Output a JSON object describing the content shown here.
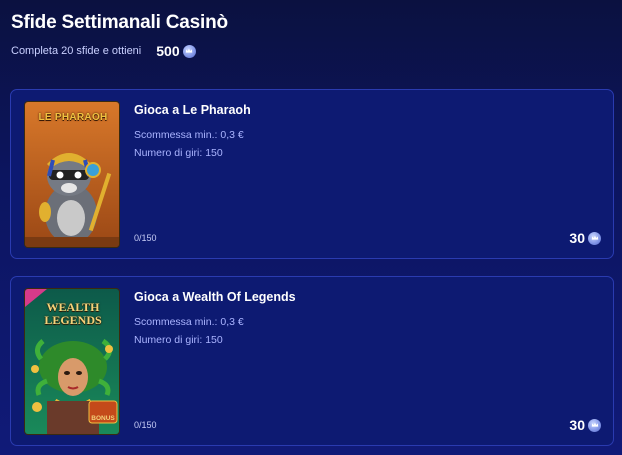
{
  "header": {
    "title": "Sfide Settimanali Casinò",
    "subtitle": "Completa 20 sfide e ottieni",
    "total_reward": "500",
    "coin_icon": "crown-coin-icon"
  },
  "challenges": [
    {
      "title": "Gioca a Le Pharaoh",
      "min_bet": "Scommessa min.: 0,3 €",
      "spins": "Numero di giri: 150",
      "progress": "0/150",
      "reward": "30",
      "thumbnail_logo": "LE PHARAOH"
    },
    {
      "title": "Gioca a Wealth Of Legends",
      "min_bet": "Scommessa min.: 0,3 €",
      "spins": "Numero di giri: 150",
      "progress": "0/150",
      "reward": "30",
      "thumbnail_logo_line1": "WEALTH",
      "thumbnail_logo_line2": "LEGENDS",
      "thumbnail_badge": "BONUS"
    }
  ],
  "colors": {
    "background": "#0c1560",
    "card": "#0d1a72",
    "card_border": "#2a3bb0",
    "meta_text": "#aab4ff",
    "coin": "#7f93e6"
  }
}
